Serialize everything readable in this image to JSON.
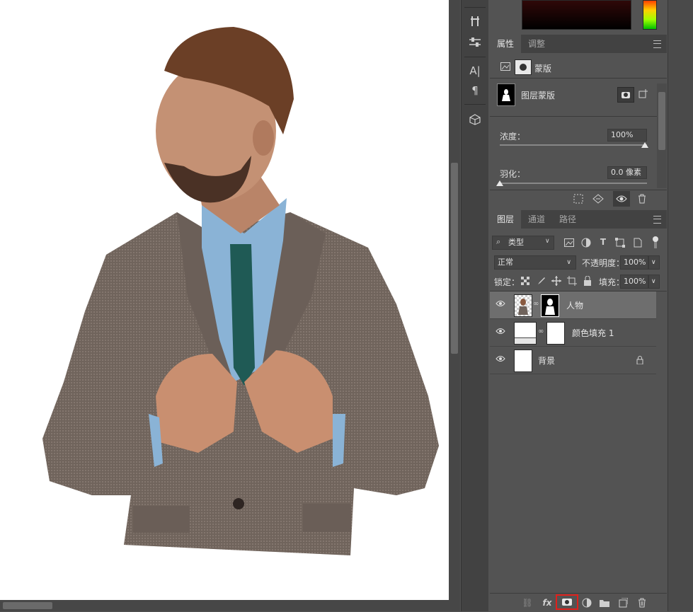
{
  "properties_panel": {
    "tabs": [
      "属性",
      "调整"
    ],
    "mask_type_label": "蒙版",
    "layer_mask_label": "图层蒙版",
    "density_label": "浓度：",
    "density_value": "100%",
    "feather_label": "羽化：",
    "feather_value": "0.0 像素"
  },
  "layers_panel": {
    "tabs": [
      "图层",
      "通道",
      "路径"
    ],
    "filter_kind": "类型",
    "blend_mode": "正常",
    "opacity_label": "不透明度：",
    "opacity_value": "100%",
    "lock_label": "锁定：",
    "fill_label": "填充：",
    "fill_value": "100%",
    "layers": [
      {
        "name": "人物",
        "selected": true
      },
      {
        "name": "颜色填充 1",
        "selected": false
      },
      {
        "name": "背景",
        "selected": false,
        "locked": true
      }
    ]
  },
  "tools": [
    "brush-settings-icon",
    "properties-sliders-icon",
    "character-icon",
    "paragraph-icon",
    "3d-cube-icon"
  ],
  "bottom_icons": [
    "link-icon",
    "fx-icon",
    "add-mask-icon",
    "adjustment-icon",
    "folder-icon",
    "new-layer-icon",
    "trash-icon"
  ],
  "colors": {
    "panel_bg": "#535353",
    "selected_layer": "#6e6e6e",
    "highlight_box": "#e0201c"
  }
}
